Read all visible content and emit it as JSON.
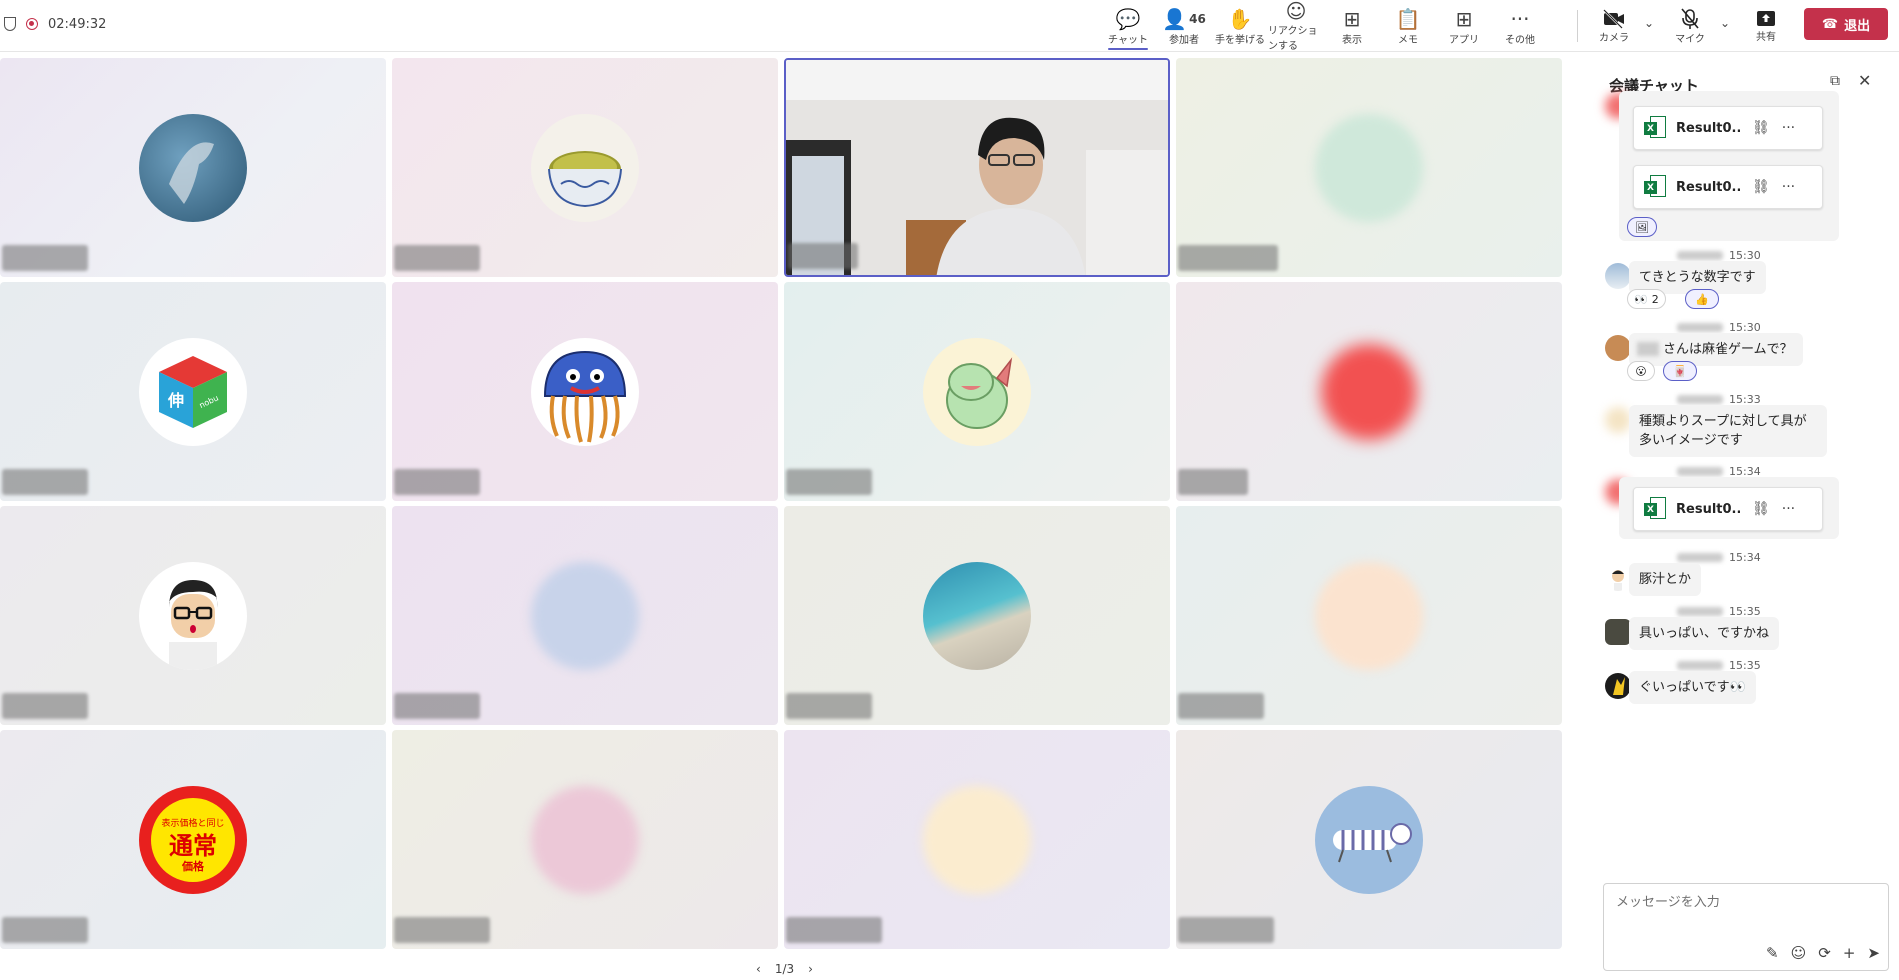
{
  "meeting": {
    "elapsed": "02:49:32"
  },
  "toolbar": {
    "tools": [
      {
        "label": "チャット",
        "icon": "chat-icon",
        "glyph": "💬"
      },
      {
        "label": "参加者",
        "icon": "people-icon",
        "glyph": "👤",
        "count": "46"
      },
      {
        "label": "手を挙げる",
        "icon": "raise-hand-icon",
        "glyph": "✋"
      },
      {
        "label": "リアクションする",
        "icon": "reaction-icon",
        "glyph": "☺"
      },
      {
        "label": "表示",
        "icon": "view-grid-icon",
        "glyph": "⊞"
      },
      {
        "label": "メモ",
        "icon": "notes-icon",
        "glyph": "📋"
      },
      {
        "label": "アプリ",
        "icon": "apps-icon",
        "glyph": "⊞"
      },
      {
        "label": "その他",
        "icon": "more-icon",
        "glyph": "···"
      }
    ],
    "camera": "カメラ",
    "mic": "マイク",
    "share": "共有",
    "leave": "退出"
  },
  "pager": "1/3",
  "chat": {
    "title": "会議チャット",
    "file_name": "Result0...",
    "messages": [
      {
        "time": "15:30",
        "text": "てきとうな数字です",
        "reaction_count": "2"
      },
      {
        "time": "15:30",
        "text": "さんは麻雀ゲームで？"
      },
      {
        "time": "15:33",
        "text": "種類よりスープに対して具が多いイメージです"
      },
      {
        "time": "15:34"
      },
      {
        "time": "15:34",
        "text": "豚汁とか"
      },
      {
        "time": "15:35",
        "text": "具いっぱい、ですかね"
      },
      {
        "time": "15:35",
        "text": "ぐいっぱいです👀"
      }
    ],
    "placeholder": "メッセージを入力"
  },
  "colors": {
    "accent": "#5b5fc7",
    "leave": "#c4314b",
    "excel": "#107c41"
  }
}
